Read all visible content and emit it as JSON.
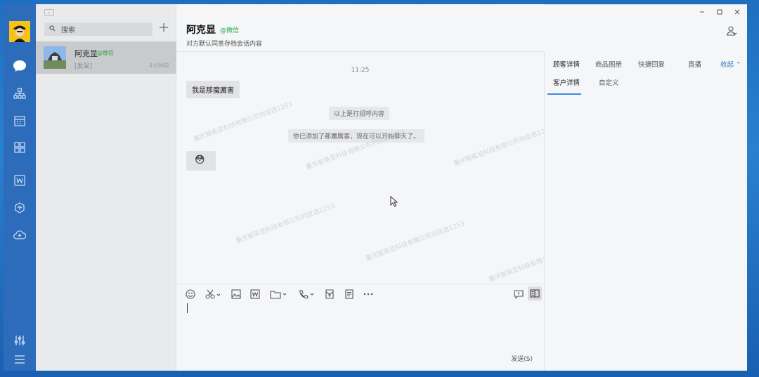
{
  "sessions": {
    "search_placeholder": "搜索",
    "active": {
      "name": "阿克显",
      "source": "@微信",
      "last_message": "[发呆]",
      "time": "4分钟前"
    }
  },
  "chat": {
    "title": "阿克显",
    "source": "@微信",
    "subtitle": "对方默认同意存档会话内容",
    "timestamp": "11:25",
    "messages": [
      {
        "type": "bubble",
        "text": "我是那魔厲害"
      },
      {
        "type": "system",
        "text": "以上是打招呼内容"
      },
      {
        "type": "system",
        "text": "你已添加了那魔厲害，现在可以开始聊天了。"
      },
      {
        "type": "emoji",
        "text": "😳"
      }
    ],
    "watermark": "重庆智英亚科技有限公司刘应选1253",
    "send_label": "发送(S)"
  },
  "panel": {
    "tabs": [
      "顾客详情",
      "商品图册",
      "快捷回复",
      "直播"
    ],
    "collapse_label": "收起 ⌃",
    "subtabs": [
      "客户详情",
      "自定义"
    ]
  },
  "colors": {
    "rail": "#2d6cba",
    "accent": "#3d8be0",
    "wechat_green": "#2aa34a"
  }
}
